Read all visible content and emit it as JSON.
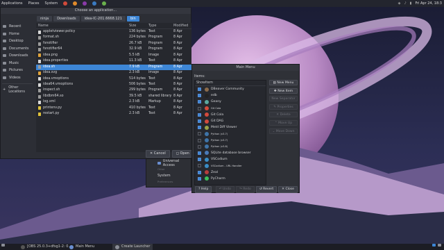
{
  "topbar": {
    "applications": "Applications",
    "places": "Places",
    "system": "System",
    "clock": "Fri Apr 24, 18:3"
  },
  "file_dialog": {
    "title": "Choose an application...",
    "breadcrumbs": [
      "ninja",
      "Downloads",
      "idea-IC-201.6668.121",
      "bin"
    ],
    "sidebar": [
      "Recent",
      "Home",
      "Desktop",
      "Documents",
      "Downloads",
      "Music",
      "Pictures",
      "Videos",
      "Other Locations"
    ],
    "columns": {
      "name": "Name",
      "size": "Size",
      "type": "Type",
      "modified": "Modified"
    },
    "files": [
      {
        "name": "appletviewer.policy",
        "size": "136 bytes",
        "type": "Text",
        "modified": "8 Apr",
        "icon_color": "#d8d8d8"
      },
      {
        "name": "format.sh",
        "size": "224 bytes",
        "type": "Program",
        "modified": "8 Apr",
        "icon_color": "#9b9b9b"
      },
      {
        "name": "fsnotifier",
        "size": "26.7 kB",
        "type": "Program",
        "modified": "8 Apr",
        "icon_color": "#9b9b9b"
      },
      {
        "name": "fsnotifier64",
        "size": "32.9 kB",
        "type": "Program",
        "modified": "8 Apr",
        "icon_color": "#9b9b9b"
      },
      {
        "name": "idea.png",
        "size": "5.5 kB",
        "type": "Image",
        "modified": "8 Apr",
        "icon_color": "#e0a33a"
      },
      {
        "name": "idea.properties",
        "size": "11.3 kB",
        "type": "Text",
        "modified": "8 Apr",
        "icon_color": "#d8d8d8"
      },
      {
        "name": "idea.sh",
        "size": "7.9 kB",
        "type": "Program",
        "modified": "8 Apr",
        "icon_color": "#9b9b9b",
        "selected": true
      },
      {
        "name": "idea.svg",
        "size": "2.3 kB",
        "type": "Image",
        "modified": "8 Apr",
        "icon_color": "#e0a33a"
      },
      {
        "name": "idea.vmoptions",
        "size": "514 bytes",
        "type": "Text",
        "modified": "8 Apr",
        "icon_color": "#d8d8d8"
      },
      {
        "name": "idea64.vmoptions",
        "size": "506 bytes",
        "type": "Text",
        "modified": "8 Apr",
        "icon_color": "#d8d8d8"
      },
      {
        "name": "inspect.sh",
        "size": "299 bytes",
        "type": "Program",
        "modified": "8 Apr",
        "icon_color": "#9b9b9b"
      },
      {
        "name": "libdbm64.so",
        "size": "39.5 kB",
        "type": "shared library",
        "modified": "8 Apr",
        "icon_color": "#9b9b9b"
      },
      {
        "name": "log.xml",
        "size": "2.3 kB",
        "type": "Markup",
        "modified": "8 Apr",
        "icon_color": "#d8d8d8"
      },
      {
        "name": "printenv.py",
        "size": "410 bytes",
        "type": "Text",
        "modified": "8 Apr",
        "icon_color": "#e0c23a"
      },
      {
        "name": "restart.py",
        "size": "2.3 kB",
        "type": "Text",
        "modified": "8 Apr",
        "icon_color": "#e0c23a"
      }
    ],
    "cancel": "Cancel",
    "open": "Open"
  },
  "settings_behind": {
    "items": [
      "Accessibility",
      "Universal Access",
      "Other",
      "System",
      "Preferences"
    ]
  },
  "menu_editor": {
    "title": "Main Menu",
    "items_label": "Items:",
    "show_header": "Show",
    "item_header": "Item",
    "rows": [
      {
        "name": "DBeaver Community",
        "checked": true,
        "color": "#8b6a4a"
      },
      {
        "name": "edb",
        "checked": true,
        "color": "#222"
      },
      {
        "name": "Geany",
        "checked": true,
        "color": "#5aa7a0"
      },
      {
        "name": "Git Cola",
        "checked": false,
        "color": "#d24a3c",
        "small": true
      },
      {
        "name": "Git Cola",
        "checked": true,
        "color": "#d24a3c"
      },
      {
        "name": "Git DAG",
        "checked": true,
        "color": "#d24a3c"
      },
      {
        "name": "Meld Diff Viewer",
        "checked": true,
        "color": "#9aa246"
      },
      {
        "name": "Python (v3.7)",
        "checked": false,
        "color": "#3f74a8",
        "small": true
      },
      {
        "name": "Python (v3.7)",
        "checked": false,
        "color": "#3f74a8",
        "small": true
      },
      {
        "name": "Python (v3.8)",
        "checked": false,
        "color": "#3f74a8",
        "small": true
      },
      {
        "name": "SQLite database browser",
        "checked": true,
        "color": "#4a7ab8"
      },
      {
        "name": "VSCodium",
        "checked": true,
        "color": "#3a8cc4"
      },
      {
        "name": "VSCodium - URL Handler",
        "checked": false,
        "color": "#3a8cc4",
        "small": true
      },
      {
        "name": "Zeal",
        "checked": true,
        "color": "#b63d3d"
      },
      {
        "name": "PyCharm",
        "checked": true,
        "color": "#3cc05a"
      }
    ],
    "right_buttons": [
      {
        "label": "New Menu",
        "enabled": true
      },
      {
        "label": "New Item",
        "enabled": true
      },
      {
        "label": "New Separator",
        "enabled": false
      },
      {
        "label": "Properties",
        "enabled": false
      },
      {
        "label": "Delete",
        "enabled": false
      },
      {
        "label": "Move Up",
        "enabled": false
      },
      {
        "label": "Move Down",
        "enabled": false
      }
    ],
    "help": "Help",
    "undo": "Undo",
    "redo": "Redo",
    "revert": "Revert",
    "close": "Close"
  },
  "bottombar": {
    "item1": "[OBS 25.0.3+dfsg1-2: 0...",
    "item2": "Main Menu",
    "item3": "Create Launcher"
  }
}
